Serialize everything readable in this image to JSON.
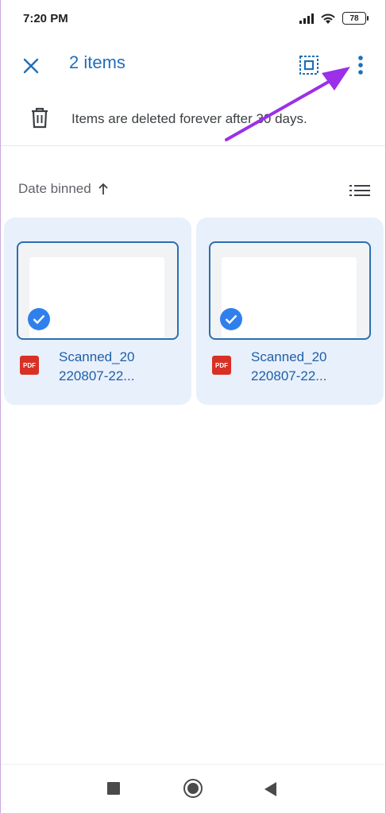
{
  "status_bar": {
    "time": "7:20 PM",
    "battery": "78",
    "icons": [
      "signal-icon",
      "wifi-icon",
      "battery-icon"
    ]
  },
  "app_bar": {
    "title": "2 items",
    "close_icon": "close-icon",
    "select_all_icon": "select-all-icon",
    "more_icon": "more-vert-icon"
  },
  "info_banner": {
    "icon": "trash-icon",
    "text": "Items are deleted forever after 30 days."
  },
  "sort": {
    "label": "Date binned",
    "direction_icon": "arrow-up-icon",
    "view_icon": "list-view-icon"
  },
  "files": [
    {
      "name_line1": "Scanned_20",
      "name_line2": "220807-22...",
      "type": "PDF",
      "selected": true
    },
    {
      "name_line1": "Scanned_20",
      "name_line2": "220807-22...",
      "type": "PDF",
      "selected": true
    }
  ],
  "colors": {
    "accent": "#1f6fb8",
    "card_bg": "#e8f0fb",
    "check": "#2f80ed",
    "pdf": "#d93025",
    "annotation_arrow": "#9b30e8"
  }
}
